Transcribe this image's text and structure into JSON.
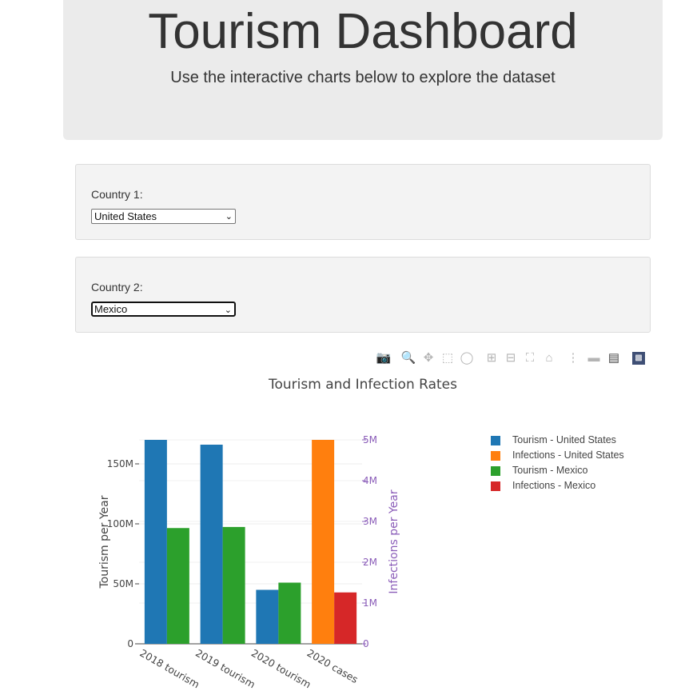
{
  "header": {
    "title": "Tourism Dashboard",
    "subtitle": "Use the interactive charts below to explore the dataset"
  },
  "filters": [
    {
      "label": "Country 1:",
      "selected": "United States"
    },
    {
      "label": "Country 2:",
      "selected": "Mexico"
    }
  ],
  "modebar": [
    "camera-icon",
    "zoom-icon",
    "pan-icon",
    "box-select-icon",
    "lasso-select-icon",
    "zoom-in-icon",
    "zoom-out-icon",
    "autoscale-icon",
    "reset-axes-icon",
    "spike-lines-icon",
    "hover-closest-icon",
    "hover-compare-icon",
    "plotly-logo-icon"
  ],
  "chart_data": {
    "type": "bar",
    "title": "Tourism and Infection Rates",
    "categories": [
      "2018 tourism",
      "2019 tourism",
      "2020 tourism",
      "2020 cases"
    ],
    "ylabel": "Tourism per Year",
    "y2label": "Infections per Year",
    "ylim": [
      0,
      170000000
    ],
    "y2lim": [
      0,
      5000000
    ],
    "yticks": [
      "0",
      "50M",
      "100M",
      "150M"
    ],
    "y2ticks": [
      "0",
      "1M",
      "2M",
      "3M",
      "4M",
      "5M"
    ],
    "legend_position": "top-right",
    "series": [
      {
        "name": "Tourism - United States",
        "axis": "y",
        "color": "#1f77b4",
        "values": [
          170000000,
          166000000,
          45000000,
          null
        ]
      },
      {
        "name": "Infections - United States",
        "axis": "y2",
        "color": "#ff7f0e",
        "values": [
          null,
          null,
          null,
          5000000
        ]
      },
      {
        "name": "Tourism - Mexico",
        "axis": "y",
        "color": "#2ca02c",
        "values": [
          96500000,
          97400000,
          51000000,
          null
        ]
      },
      {
        "name": "Infections - Mexico",
        "axis": "y2",
        "color": "#d62728",
        "values": [
          null,
          null,
          null,
          1260000
        ]
      }
    ]
  }
}
